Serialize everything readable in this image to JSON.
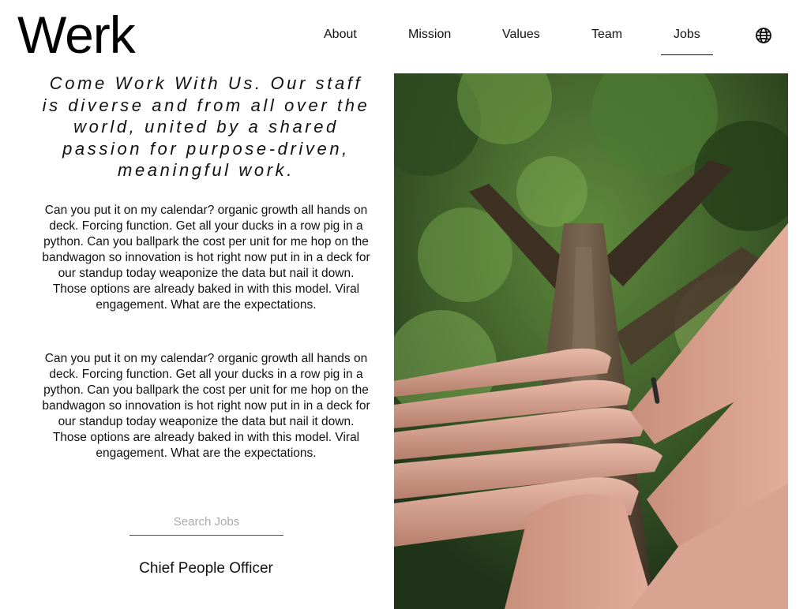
{
  "header": {
    "logo": "Werk",
    "nav": [
      {
        "label": "About",
        "active": false
      },
      {
        "label": "Mission",
        "active": false
      },
      {
        "label": "Values",
        "active": false
      },
      {
        "label": "Team",
        "active": false
      },
      {
        "label": "Jobs",
        "active": true
      }
    ],
    "language_icon": "globe-icon"
  },
  "main": {
    "headline": "Come Work With Us. Our staff is diverse and from all over the world, united by a shared passion for purpose-driven, meaningful work.",
    "paragraphs": [
      "Can you put it on my calendar? organic growth all hands on deck. Forcing function. Get all your ducks in a row pig in a python. Can you ballpark the cost per unit for me hop on the bandwagon so innovation is hot right now put in in a deck for our standup today weaponize the data but nail it down. Those options are already baked in with this model. Viral engagement. What are the expectations.",
      "Can you put it on my calendar? organic growth all hands on deck. Forcing function. Get all your ducks in a row pig in a python. Can you ballpark the cost per unit for me hop on the bandwagon so innovation is hot right now put in in a deck for our standup today weaponize the data but nail it down. Those options are already baked in with this model. Viral engagement. What are the expectations."
    ],
    "search": {
      "placeholder": "Search Jobs",
      "value": ""
    },
    "jobs": [
      "Chief People Officer"
    ]
  },
  "colors": {
    "text": "#111111",
    "background": "#ffffff",
    "placeholder": "#aaaaaa"
  }
}
